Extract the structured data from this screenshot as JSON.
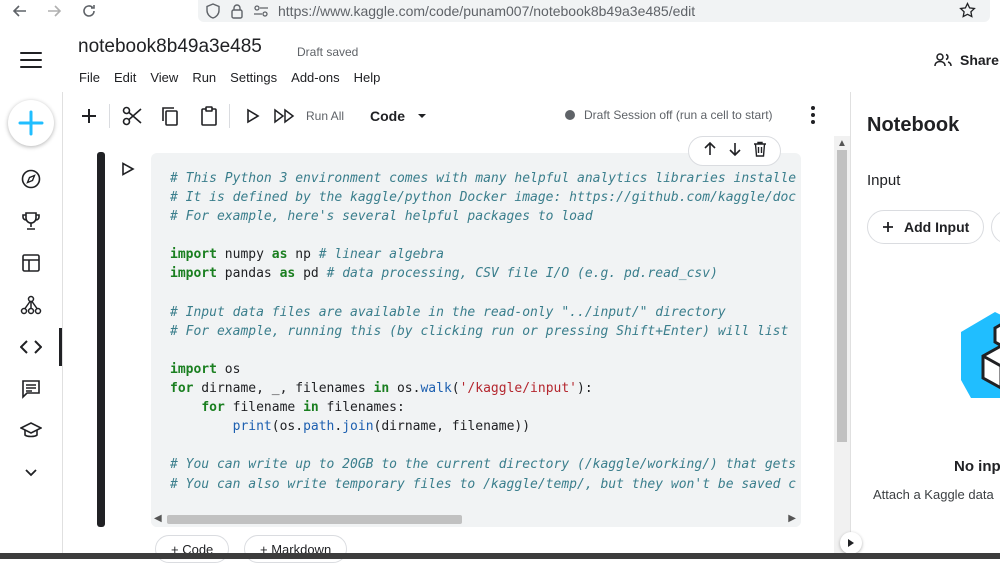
{
  "browser": {
    "url": "https://www.kaggle.com/code/punam007/notebook8b49a3e485/edit"
  },
  "header": {
    "title": "notebook8b49a3e485",
    "status": "Draft saved",
    "menu": [
      "File",
      "Edit",
      "View",
      "Run",
      "Settings",
      "Add-ons",
      "Help"
    ],
    "share_label": "Share"
  },
  "toolbar": {
    "run_all_label": "Run All",
    "cell_type": "Code",
    "session_status": "Draft Session off (run a cell to start)"
  },
  "cell": {
    "lines": [
      [
        {
          "t": "# This Python 3 environment comes with many helpful analytics libraries installe",
          "c": "com"
        }
      ],
      [
        {
          "t": "# It is defined by the kaggle/python Docker image: https://github.com/kaggle/doc",
          "c": "com"
        }
      ],
      [
        {
          "t": "# For example, here's several helpful packages to load",
          "c": "com"
        }
      ],
      [],
      [
        {
          "t": "import",
          "c": "kw"
        },
        {
          "t": " numpy ",
          "c": "plain"
        },
        {
          "t": "as",
          "c": "kw"
        },
        {
          "t": " np ",
          "c": "plain"
        },
        {
          "t": "# linear algebra",
          "c": "com"
        }
      ],
      [
        {
          "t": "import",
          "c": "kw"
        },
        {
          "t": " pandas ",
          "c": "plain"
        },
        {
          "t": "as",
          "c": "kw"
        },
        {
          "t": " pd ",
          "c": "plain"
        },
        {
          "t": "# data processing, CSV file I/O (e.g. pd.read_csv)",
          "c": "com"
        }
      ],
      [],
      [
        {
          "t": "# Input data files are available in the read-only \"../input/\" directory",
          "c": "com"
        }
      ],
      [
        {
          "t": "# For example, running this (by clicking run or pressing Shift+Enter) will list",
          "c": "com"
        }
      ],
      [],
      [
        {
          "t": "import",
          "c": "kw"
        },
        {
          "t": " os",
          "c": "plain"
        }
      ],
      [
        {
          "t": "for",
          "c": "kw"
        },
        {
          "t": " dirname, _, filenames ",
          "c": "plain"
        },
        {
          "t": "in",
          "c": "kw"
        },
        {
          "t": " os.",
          "c": "plain"
        },
        {
          "t": "walk",
          "c": "fn"
        },
        {
          "t": "(",
          "c": "plain"
        },
        {
          "t": "'/kaggle/input'",
          "c": "str"
        },
        {
          "t": "):",
          "c": "plain"
        }
      ],
      [
        {
          "t": "    ",
          "c": "plain"
        },
        {
          "t": "for",
          "c": "kw"
        },
        {
          "t": " filename ",
          "c": "plain"
        },
        {
          "t": "in",
          "c": "kw"
        },
        {
          "t": " filenames:",
          "c": "plain"
        }
      ],
      [
        {
          "t": "        ",
          "c": "plain"
        },
        {
          "t": "print",
          "c": "fn"
        },
        {
          "t": "(os.",
          "c": "plain"
        },
        {
          "t": "path",
          "c": "fn"
        },
        {
          "t": ".",
          "c": "plain"
        },
        {
          "t": "join",
          "c": "fn"
        },
        {
          "t": "(dirname, filename))",
          "c": "plain"
        }
      ],
      [],
      [
        {
          "t": "# You can write up to 20GB to the current directory (/kaggle/working/) that gets",
          "c": "com"
        }
      ],
      [
        {
          "t": "# You can also write temporary files to /kaggle/temp/, but they won't be saved c",
          "c": "com"
        }
      ]
    ],
    "add_code_label": "+ Code",
    "add_markdown_label": "+ Markdown"
  },
  "right_panel": {
    "title": "Notebook",
    "section": "Input",
    "add_input_label": "Add Input",
    "empty_title": "No inp",
    "empty_text": "Attach a Kaggle data"
  },
  "colors": {
    "kaggle_blue": "#20beff",
    "comment": "#3a7e8c",
    "keyword": "#1a7f20",
    "string": "#b4262e"
  }
}
